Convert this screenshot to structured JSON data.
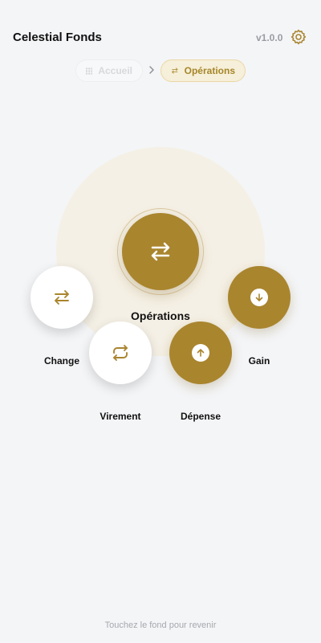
{
  "header": {
    "title": "Celestial Fonds",
    "version": "v1.0.0",
    "settings_icon": "gear-icon"
  },
  "breadcrumb": {
    "home": {
      "label": "Accueil",
      "icon": "grid-icon"
    },
    "separator_icon": "chevron-right-icon",
    "current": {
      "label": "Opérations",
      "icon": "arrows-exchange-icon"
    }
  },
  "radial_menu": {
    "center": {
      "label": "Opérations",
      "icon": "arrows-exchange-icon"
    },
    "items": [
      {
        "label": "Change",
        "icon": "arrows-exchange-icon",
        "style": "white"
      },
      {
        "label": "Virement",
        "icon": "repeat-icon",
        "style": "white"
      },
      {
        "label": "Dépense",
        "icon": "arrow-up-icon",
        "style": "gold"
      },
      {
        "label": "Gain",
        "icon": "arrow-down-icon",
        "style": "gold"
      }
    ]
  },
  "footer": {
    "hint": "Touchez le fond pour revenir"
  },
  "colors": {
    "background": "#f4f5f7",
    "accent_gold": "#a9852e",
    "halo": "#f5f0e5",
    "text": "#111111",
    "muted": "#9a9ca3"
  }
}
